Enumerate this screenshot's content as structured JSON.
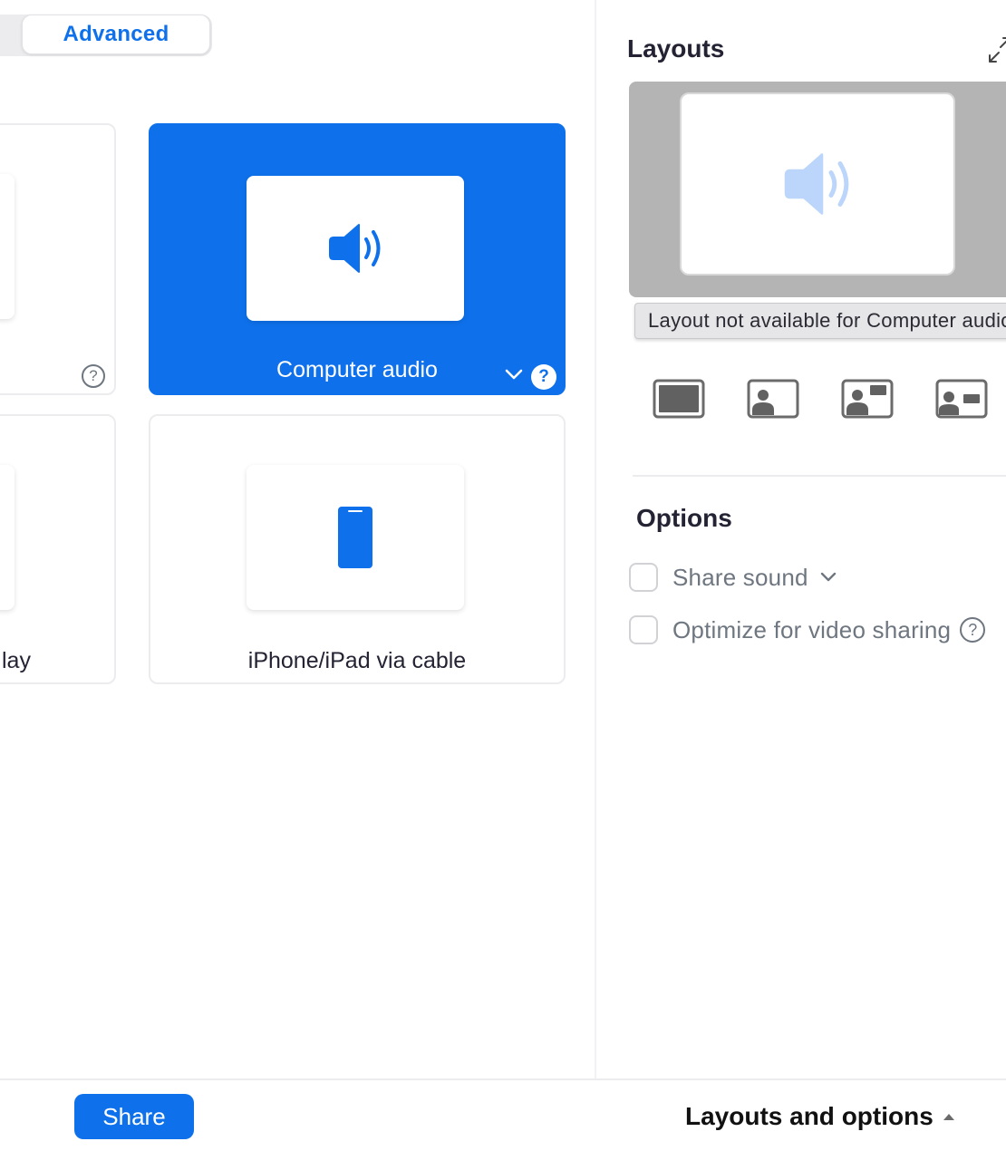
{
  "tabs": {
    "advanced_label": "Advanced"
  },
  "cards": {
    "computer_audio": {
      "label": "Computer audio",
      "selected": true
    },
    "iphone_cable": {
      "label": "iPhone/iPad via cable"
    },
    "partial_left_label": "lay"
  },
  "layouts_panel": {
    "title": "Layouts",
    "tooltip": "Layout not available for Computer audio",
    "layout_icons": [
      "layout-full-icon",
      "layout-small-video-icon",
      "layout-side-video-icon",
      "layout-presenter-icon"
    ]
  },
  "options": {
    "title": "Options",
    "share_sound_label": "Share sound",
    "optimize_video_label": "Optimize for video sharing"
  },
  "footer": {
    "share_label": "Share",
    "layouts_toggle_label": "Layouts and options"
  },
  "colors": {
    "accent": "#0e71eb",
    "muted_text": "#6e7680",
    "preview_bg": "#b4b4b4"
  }
}
